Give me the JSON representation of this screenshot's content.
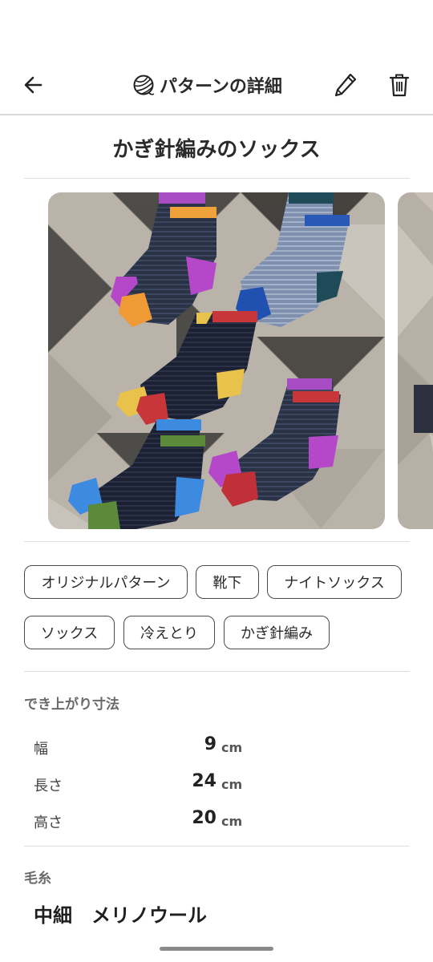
{
  "header": {
    "title": "パターンの詳細",
    "back_icon": "arrow-left-icon",
    "title_icon": "yarn-ball-icon",
    "edit_icon": "pencil-icon",
    "delete_icon": "trash-icon"
  },
  "pattern": {
    "title": "かぎ針編みのソックス"
  },
  "gallery": {
    "photos": [
      "crocheted-socks-photo",
      "crocheted-socks-photo-2"
    ]
  },
  "tags": [
    "オリジナルパターン",
    "靴下",
    "ナイトソックス",
    "ソックス",
    "冷えとり",
    "かぎ針編み"
  ],
  "dimensions": {
    "label": "でき上がり寸法",
    "rows": [
      {
        "label": "幅",
        "value": "9",
        "unit": "cm"
      },
      {
        "label": "長さ",
        "value": "24",
        "unit": "cm"
      },
      {
        "label": "高さ",
        "value": "20",
        "unit": "cm"
      }
    ]
  },
  "yarn": {
    "label": "毛糸",
    "value": "中細　メリノウール"
  },
  "colors": {
    "divider": "#dedede",
    "tag_border": "#4a4a4a",
    "text": "#222222",
    "muted": "#6a6a6a"
  }
}
